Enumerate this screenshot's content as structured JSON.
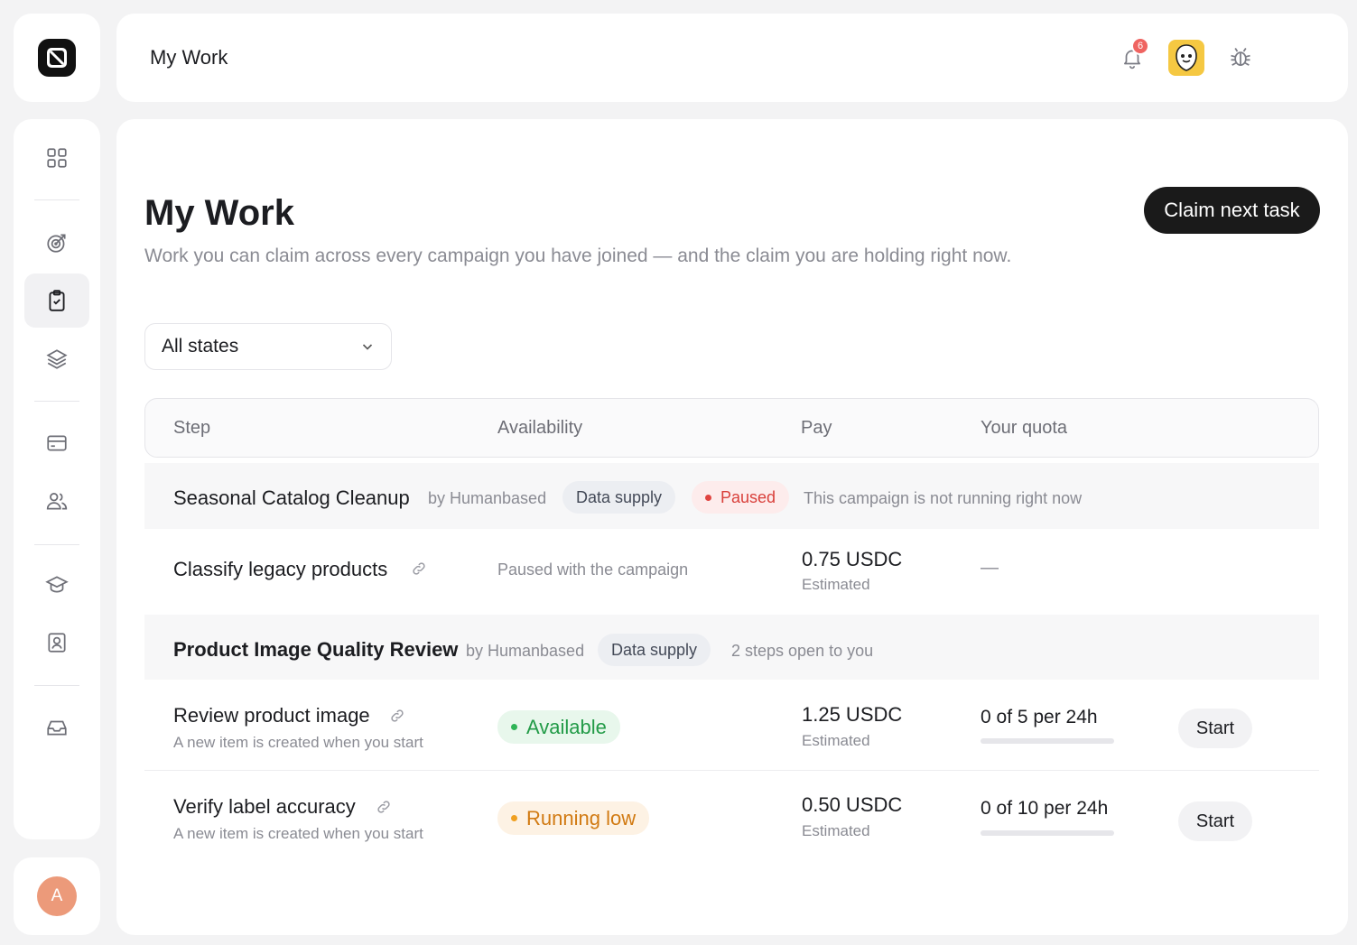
{
  "topbar": {
    "title": "My Work",
    "notification_count": "6"
  },
  "user": {
    "initial": "A"
  },
  "page": {
    "title": "My Work",
    "subtitle": "Work you can claim across every campaign you have joined — and the claim you are holding right now.",
    "claim_button": "Claim next task"
  },
  "filter": {
    "selected": "All states"
  },
  "table": {
    "headers": [
      "Step",
      "Availability",
      "Pay",
      "Your quota"
    ]
  },
  "groups": [
    {
      "name": "Seasonal Catalog Cleanup",
      "by": "by Humanbased",
      "tag": "Data supply",
      "status": "Paused",
      "note": "This campaign is not running right now",
      "tasks": [
        {
          "name": "Classify legacy products",
          "availability": "Paused with the campaign",
          "pay": "0.75 USDC",
          "pay_sub": "Estimated",
          "quota": "—"
        }
      ]
    },
    {
      "name": "Product Image Quality Review",
      "by": "by Humanbased",
      "tag": "Data supply",
      "note": "2 steps open to you",
      "tasks": [
        {
          "name": "Review product image",
          "sub": "A new item is created when you start",
          "status": "Available",
          "pay": "1.25 USDC",
          "pay_sub": "Estimated",
          "quota": "0 of 5 per 24h",
          "quota_fraction": 0,
          "action": "Start"
        },
        {
          "name": "Verify label accuracy",
          "sub": "A new item is created when you start",
          "status": "Running low",
          "pay": "0.50 USDC",
          "pay_sub": "Estimated",
          "quota": "0 of 10 per 24h",
          "quota_fraction": 0,
          "action": "Start"
        }
      ]
    }
  ],
  "colors": {
    "accent_dark": "#1a1a1a",
    "paused": "#d9403b",
    "available": "#239b48",
    "running_low": "#d17a12",
    "notification": "#ef6461"
  },
  "icons": {
    "sidebar": [
      "dashboard-grid-icon",
      "target-icon",
      "clipboard-check-icon",
      "layers-icon",
      "credit-card-icon",
      "users-icon",
      "graduation-cap-icon",
      "contact-badge-icon",
      "inbox-icon"
    ],
    "topbar": [
      "bell-icon",
      "mascot-icon",
      "bug-icon"
    ]
  }
}
